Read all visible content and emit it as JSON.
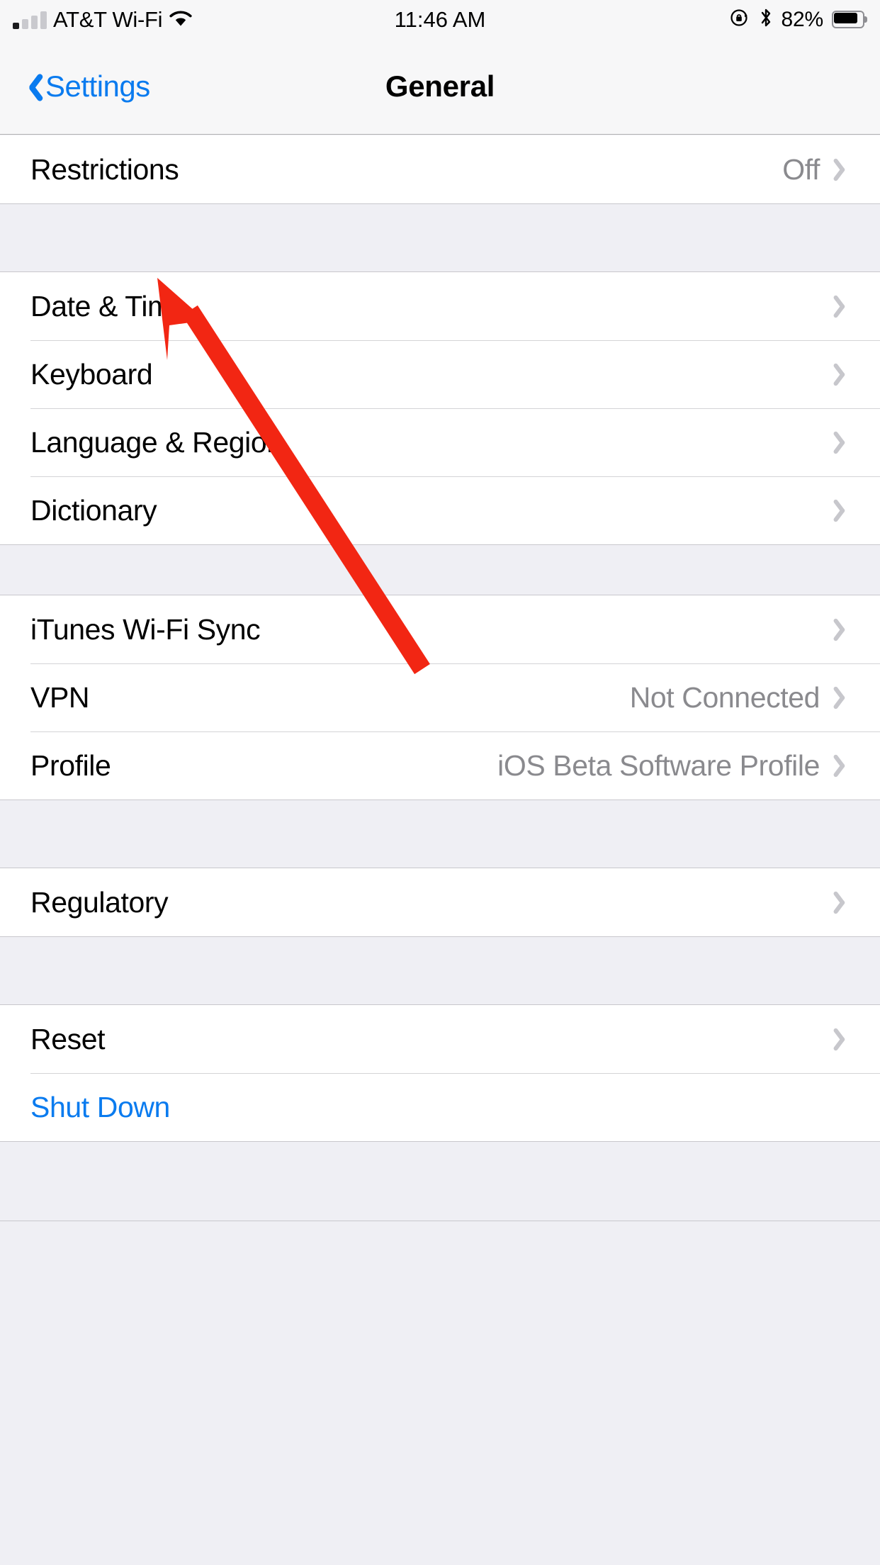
{
  "status_bar": {
    "signal_icon": "cellular-signal-icon",
    "signal_bars_filled": 1,
    "signal_bars_total": 4,
    "carrier": "AT&T Wi-Fi",
    "wifi_icon": "wifi-icon",
    "time": "11:46 AM",
    "rotation_lock_icon": "rotation-lock-icon",
    "bluetooth_icon": "bluetooth-icon",
    "battery_percent": "82%",
    "battery_level": 82,
    "battery_icon": "battery-icon"
  },
  "nav_bar": {
    "back_label": "Settings",
    "back_icon": "chevron-left-icon",
    "title": "General"
  },
  "groups": [
    {
      "id": "restrictions-group",
      "rows": [
        {
          "name": "restrictions",
          "label": "Restrictions",
          "value": "Off",
          "chevron": true,
          "link": false
        }
      ]
    },
    {
      "id": "localization-group",
      "rows": [
        {
          "name": "date-and-time",
          "label": "Date & Time",
          "value": "",
          "chevron": true,
          "link": false
        },
        {
          "name": "keyboard",
          "label": "Keyboard",
          "value": "",
          "chevron": true,
          "link": false
        },
        {
          "name": "language-and-region",
          "label": "Language & Region",
          "value": "",
          "chevron": true,
          "link": false
        },
        {
          "name": "dictionary",
          "label": "Dictionary",
          "value": "",
          "chevron": true,
          "link": false
        }
      ]
    },
    {
      "id": "connectivity-group",
      "rows": [
        {
          "name": "itunes-wifi-sync",
          "label": "iTunes Wi-Fi Sync",
          "value": "",
          "chevron": true,
          "link": false
        },
        {
          "name": "vpn",
          "label": "VPN",
          "value": "Not Connected",
          "chevron": true,
          "link": false
        },
        {
          "name": "profile",
          "label": "Profile",
          "value": "iOS Beta Software Profile",
          "chevron": true,
          "link": false
        }
      ]
    },
    {
      "id": "regulatory-group",
      "rows": [
        {
          "name": "regulatory",
          "label": "Regulatory",
          "value": "",
          "chevron": true,
          "link": false
        }
      ]
    },
    {
      "id": "reset-group",
      "rows": [
        {
          "name": "reset",
          "label": "Reset",
          "value": "",
          "chevron": true,
          "link": false
        },
        {
          "name": "shut-down",
          "label": "Shut Down",
          "value": "",
          "chevron": false,
          "link": true
        }
      ]
    }
  ],
  "annotation": {
    "name": "red-arrow-pointing-to-date-and-time",
    "color": "#F22613",
    "points_to": "Date & Time"
  },
  "colors": {
    "accent_blue": "#0A7BEF",
    "group_background": "#EFEFF4",
    "row_background": "#FFFFFF",
    "separator": "#D4D4D6",
    "secondary_text": "#8A8A8E",
    "annotation_red": "#F22613"
  }
}
